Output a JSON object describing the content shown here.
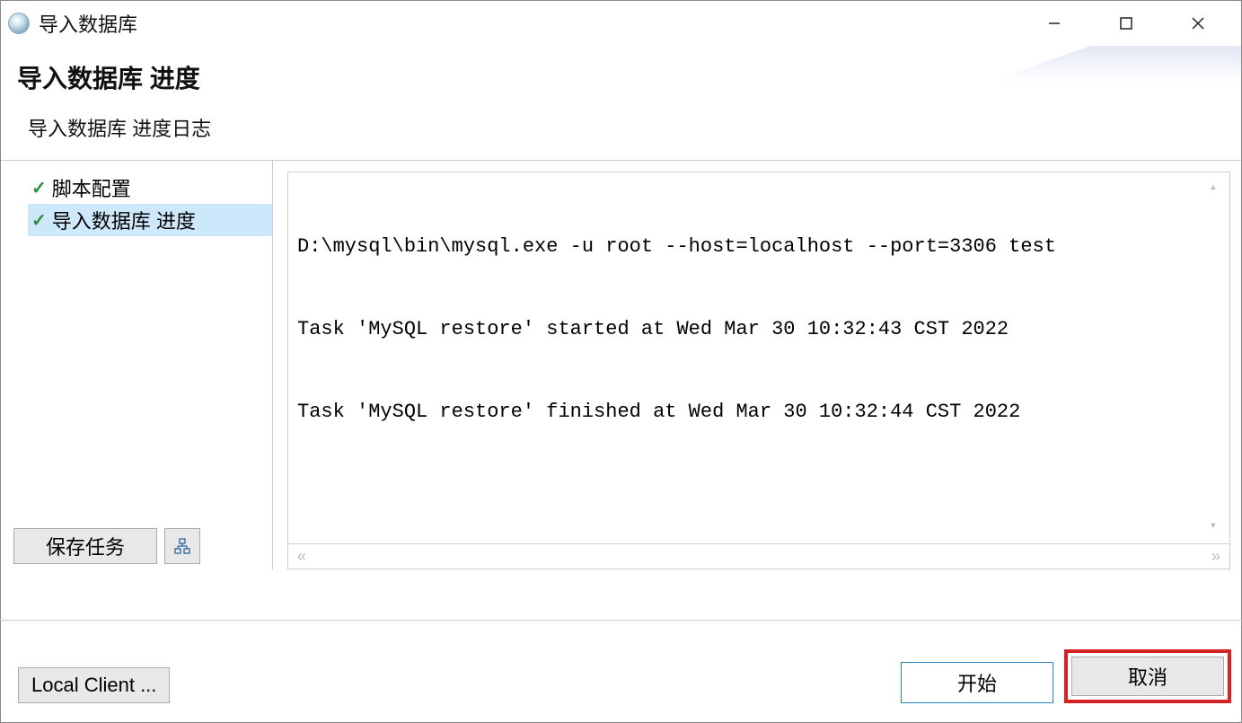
{
  "window": {
    "title": "导入数据库"
  },
  "header": {
    "title": "导入数据库 进度",
    "subtitle": "导入数据库 进度日志"
  },
  "sidebar": {
    "steps": [
      {
        "label": "脚本配置",
        "completed": true,
        "selected": false
      },
      {
        "label": "导入数据库 进度",
        "completed": true,
        "selected": true
      }
    ],
    "save_task_label": "保存任务"
  },
  "log": {
    "lines": [
      "D:\\mysql\\bin\\mysql.exe -u root --host=localhost --port=3306 test",
      "Task 'MySQL restore' started at Wed Mar 30 10:32:43 CST 2022",
      "Task 'MySQL restore' finished at Wed Mar 30 10:32:44 CST 2022"
    ]
  },
  "bottom": {
    "local_client_label": "Local Client ...",
    "start_label": "开始",
    "cancel_label": "取消"
  }
}
